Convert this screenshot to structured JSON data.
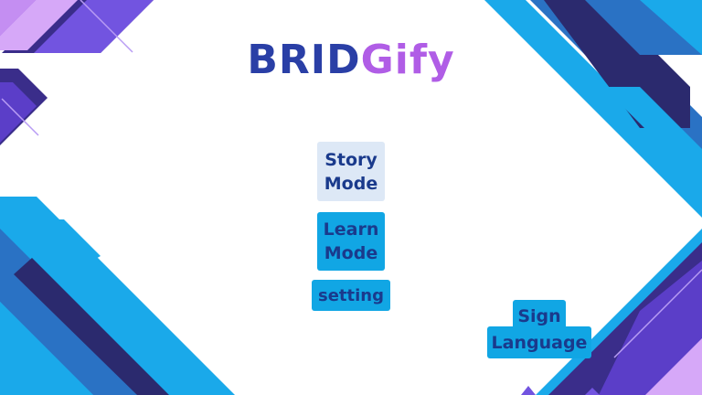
{
  "app": {
    "logo_part1": "BRID",
    "logo_part2": "Gify"
  },
  "menu": {
    "story_line1": "Story",
    "story_line2": "Mode",
    "learn_line1": "Learn",
    "learn_line2": "Mode",
    "setting": "setting"
  },
  "sign_language": {
    "line1": "Sign",
    "line2": "Language"
  },
  "colors": {
    "button_blue": "#11a6e4",
    "button_light": "#dde8f6",
    "text_navy": "#1a3a8c",
    "logo_blue": "#2a3fa6",
    "logo_purple": "#b05de6"
  }
}
